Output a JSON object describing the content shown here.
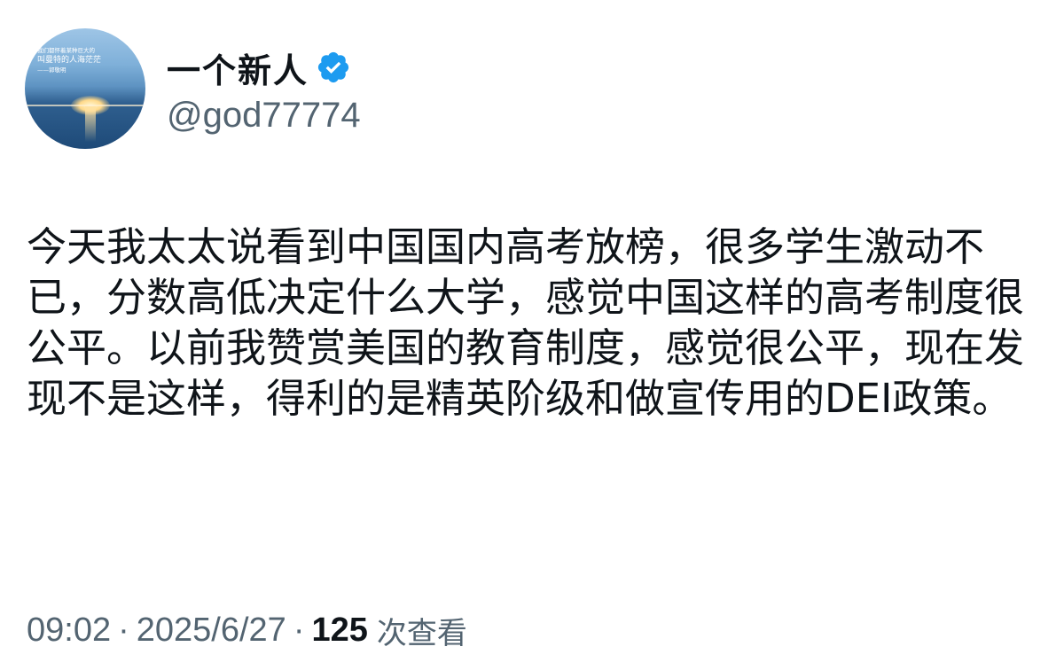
{
  "author": {
    "display_name": "一个新人",
    "handle": "@god77774",
    "avatar_quote_line1": "我们都怀着某种巨大的",
    "avatar_quote_line2": "叫曼特的人海茫茫",
    "avatar_quote_line3": "——郭敬明",
    "accent_color": "#1d9bf0"
  },
  "tweet": {
    "text": "今天我太太说看到中国国内高考放榜，很多学生激动不已，分数高低决定什么大学，感觉中国这样的高考制度很公平。以前我赞赏美国的教育制度，感觉很公平，现在发现不是这样，得利的是精英阶级和做宣传用的DEI政策。"
  },
  "meta": {
    "time": "09:02",
    "separator": "·",
    "date": "2025/6/27",
    "views_count": "125",
    "views_label": "次查看"
  }
}
